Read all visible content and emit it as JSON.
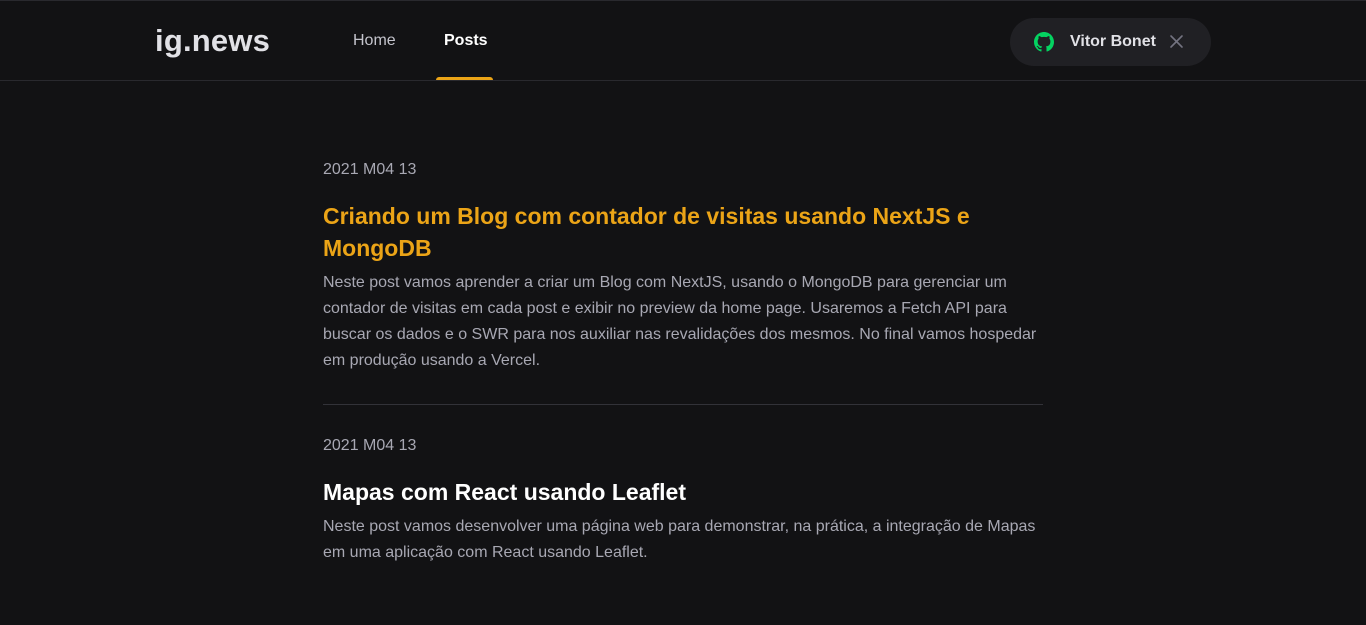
{
  "header": {
    "logo": "ig.news",
    "nav": {
      "home_label": "Home",
      "posts_label": "Posts"
    },
    "user": {
      "name": "Vitor Bonet",
      "icon": "github-icon",
      "close_icon": "close-icon"
    }
  },
  "posts": [
    {
      "date": "2021 M04 13",
      "title": "Criando um Blog com contador de visitas usando NextJS e MongoDB",
      "excerpt": "Neste post vamos aprender a criar um Blog com NextJS, usando o MongoDB para gerenciar um contador de visitas em cada post e exibir no preview da home page. Usaremos a Fetch API para buscar os dados e o SWR para nos auxiliar nas revalidações dos mesmos. No final vamos hospedar em produção usando a Vercel."
    },
    {
      "date": "2021 M04 13",
      "title": "Mapas com React usando Leaflet",
      "excerpt": "Neste post vamos desenvolver uma página web para demonstrar, na prática, a integração de Mapas em uma aplicação com React usando Leaflet."
    }
  ],
  "colors": {
    "background": "#121214",
    "accent": "#eba417",
    "github_green": "#04d361",
    "text_muted": "#a8a8b3"
  }
}
